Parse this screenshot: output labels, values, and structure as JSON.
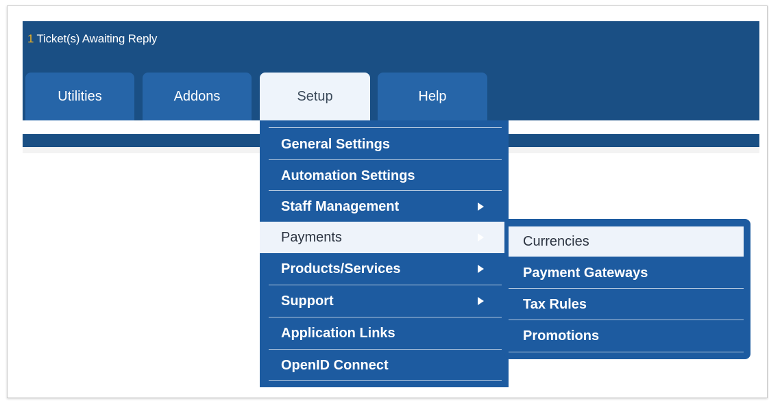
{
  "header": {
    "notice_count": "1",
    "notice_text": " Ticket(s) Awaiting Reply"
  },
  "tabs": [
    {
      "label": "Utilities",
      "active": false
    },
    {
      "label": "Addons",
      "active": false
    },
    {
      "label": "Setup",
      "active": true
    },
    {
      "label": "Help",
      "active": false
    }
  ],
  "setup_menu": {
    "items": [
      {
        "label": "General Settings",
        "has_submenu": false
      },
      {
        "label": "Automation Settings",
        "has_submenu": false
      },
      {
        "label": "Staff Management",
        "has_submenu": true
      },
      {
        "label": "Payments",
        "has_submenu": true,
        "highlighted": true
      },
      {
        "label": "Products/Services",
        "has_submenu": true
      },
      {
        "label": "Support",
        "has_submenu": true
      },
      {
        "label": "Application Links",
        "has_submenu": false
      },
      {
        "label": "OpenID Connect",
        "has_submenu": false
      }
    ]
  },
  "payments_submenu": {
    "items": [
      {
        "label": "Currencies",
        "highlighted": true
      },
      {
        "label": "Payment Gateways"
      },
      {
        "label": "Tax Rules"
      },
      {
        "label": "Promotions"
      }
    ]
  },
  "colors": {
    "header_bg": "#1a4f84",
    "tab_bg": "#2665a8",
    "menu_bg": "#1d5ba0",
    "highlight_bg": "#eef3fa",
    "notice_count": "#f0b323"
  }
}
